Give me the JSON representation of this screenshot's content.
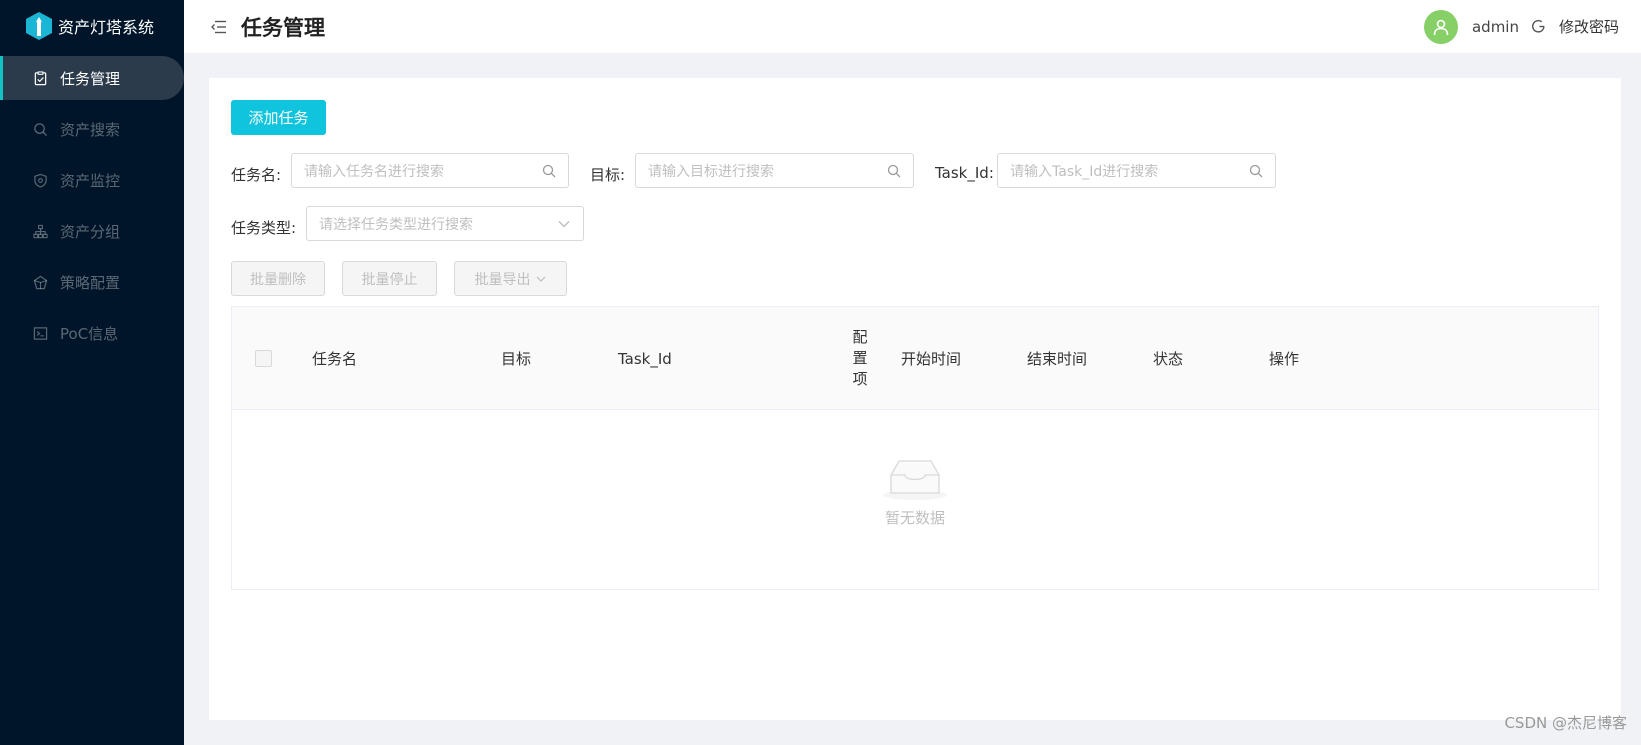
{
  "app": {
    "title": "资产灯塔系统"
  },
  "sidebar": {
    "items": [
      {
        "label": "任务管理",
        "icon": "task-check-icon",
        "active": true
      },
      {
        "label": "资产搜索",
        "icon": "search-icon"
      },
      {
        "label": "资产监控",
        "icon": "shield-icon"
      },
      {
        "label": "资产分组",
        "icon": "cluster-icon"
      },
      {
        "label": "策略配置",
        "icon": "gem-icon"
      },
      {
        "label": "PoC信息",
        "icon": "code-icon"
      }
    ]
  },
  "header": {
    "title": "任务管理",
    "username": "admin",
    "change_password": "修改密码"
  },
  "toolbar": {
    "add_task": "添加任务"
  },
  "filters": {
    "task_name": {
      "label": "任务名:",
      "placeholder": "请输入任务名进行搜索"
    },
    "target": {
      "label": "目标:",
      "placeholder": "请输入目标进行搜索"
    },
    "task_id": {
      "label": "Task_Id:",
      "placeholder": "请输入Task_Id进行搜索"
    },
    "task_type": {
      "label": "任务类型:",
      "placeholder": "请选择任务类型进行搜索"
    }
  },
  "batch": {
    "delete": "批量删除",
    "stop": "批量停止",
    "export": "批量导出"
  },
  "table": {
    "columns": [
      "任务名",
      "目标",
      "Task_Id",
      "配置项",
      "开始时间",
      "结束时间",
      "状态",
      "操作"
    ],
    "config_col_chars": [
      "配",
      "置",
      "项"
    ],
    "empty_text": "暂无数据"
  },
  "watermark": "CSDN @杰尼博客",
  "colors": {
    "sidebar_bg": "#001529",
    "primary": "#0fc4dc",
    "avatar": "#87d068"
  }
}
